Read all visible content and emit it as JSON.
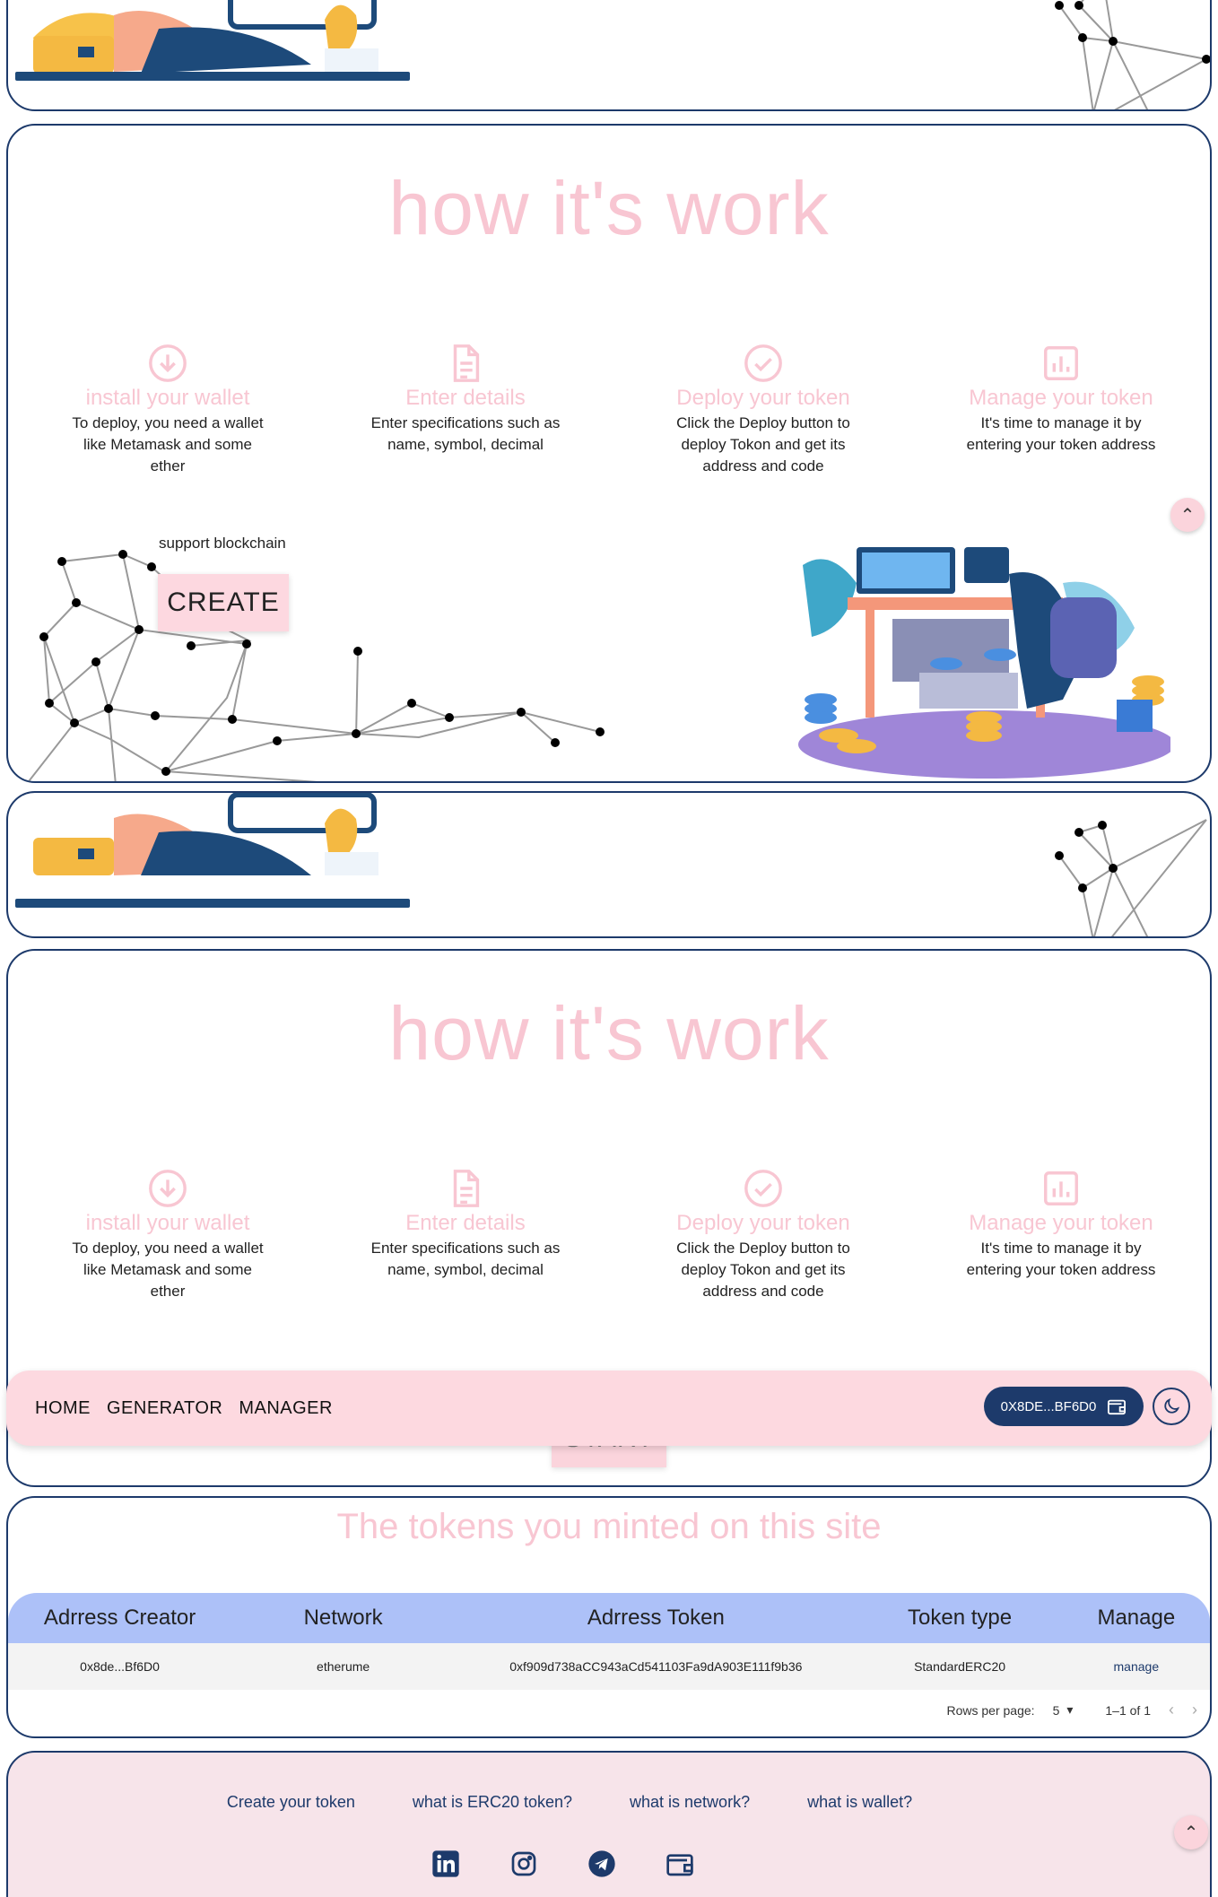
{
  "how": {
    "title": "how it's work",
    "steps": [
      {
        "title": "install your wallet",
        "text": "To deploy, you need a wallet like Metamask and some ether"
      },
      {
        "title": "Enter details",
        "text": "Enter specifications such as name, symbol, decimal"
      },
      {
        "title": "Deploy your token",
        "text": "Click the Deploy button to deploy Tokon and get its address and code"
      },
      {
        "title": "Manage your token",
        "text": "It's time to manage it by entering your token address"
      }
    ]
  },
  "hero": {
    "support_text": "support blockchain",
    "create_label": "CREATE",
    "start_label": "START"
  },
  "nav": {
    "items": [
      "HOME",
      "GENERATOR",
      "MANAGER"
    ],
    "wallet_label": "0X8DE...BF6D0"
  },
  "tokens": {
    "title": "The tokens you minted on this site",
    "columns": [
      "Adrress Creator",
      "Network",
      "Adrress Token",
      "Token type",
      "Manage"
    ],
    "rows": [
      {
        "creator": "0x8de...Bf6D0",
        "network": "etherume",
        "token": "0xf909d738aCC943aCd541103Fa9dA903E111f9b36",
        "type": "StandardERC20",
        "manage": "manage"
      }
    ],
    "pager": {
      "rows_per_page_label": "Rows per page:",
      "rows_per_page": "5",
      "range": "1–1 of 1"
    }
  },
  "footer": {
    "links": [
      "Create your token",
      "what is ERC20 token?",
      "what is network?",
      "what is wallet?"
    ],
    "social_icons": [
      "linkedin-icon",
      "instagram-icon",
      "telegram-icon",
      "wallet-icon"
    ]
  },
  "colors": {
    "navy": "#1d3a6b",
    "pink": "#fdd9e0",
    "title_pink": "#f8c6d2",
    "table_head": "#adc1f8"
  }
}
